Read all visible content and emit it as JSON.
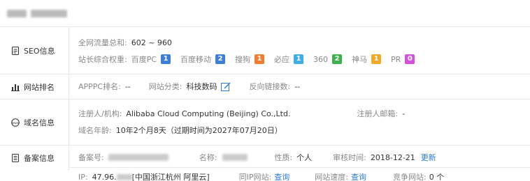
{
  "header": {
    "title_blurred": true
  },
  "seo": {
    "heading": "SEO信息",
    "traffic_label": "全网流量总和:",
    "traffic_value": "602 ~ 960",
    "weights_label": "站长综合权重:",
    "engines": [
      {
        "name": "百度PC",
        "rank": "1",
        "color": "#3d7ddb"
      },
      {
        "name": "百度移动",
        "rank": "2",
        "color": "#3d7ddb"
      },
      {
        "name": "搜狗",
        "rank": "1",
        "color": "#f07c2e"
      },
      {
        "name": "必应",
        "rank": "1",
        "color": "#3faee8"
      },
      {
        "name": "360",
        "rank": "2",
        "color": "#3cb24a"
      },
      {
        "name": "神马",
        "rank": "1",
        "color": "#f5a623"
      },
      {
        "name": "PR",
        "rank": "0",
        "color": "#d84fe0"
      }
    ]
  },
  "rank": {
    "heading": "网站排名",
    "apppc_label": "APPPC排名:",
    "apppc_value": "--",
    "category_label": "网站分类:",
    "category_value": "科技数码",
    "backlinks_label": "反向链接数:",
    "backlinks_value": "--"
  },
  "domain": {
    "heading": "域名信息",
    "registrant_label": "注册人/机构:",
    "registrant_value": "Alibaba Cloud Computing (Beijing) Co.,Ltd.",
    "email_label": "注册人邮箱:",
    "email_value": "-",
    "age_label": "域名年龄:",
    "age_value": "10年2个月8天（过期时间为2027年07月20日）"
  },
  "icp": {
    "heading": "备案信息",
    "number_label": "备案号:",
    "name_label": "名称:",
    "nature_label": "性质:",
    "nature_value": "个人",
    "time_label": "审核时间:",
    "time_value": "2018-12-21",
    "update_link": "更新"
  },
  "ip": {
    "ip_label": "IP:",
    "ip_value_prefix": "47.96.",
    "ip_location": "[中国浙江杭州 阿里云]",
    "same_ip_label": "同IP网站:",
    "same_ip_link": "查询",
    "speed_label": "网站速度:",
    "speed_link": "查询",
    "competitor_label": "竞争网站:",
    "competitor_value": "0 个"
  }
}
